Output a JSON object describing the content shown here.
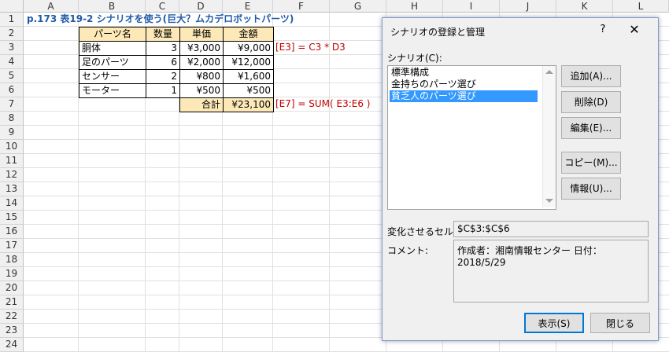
{
  "columns": [
    "A",
    "B",
    "C",
    "D",
    "E",
    "F",
    "G",
    "H",
    "I",
    "J",
    "K",
    "L"
  ],
  "rows": [
    "1",
    "2",
    "3",
    "4",
    "5",
    "6",
    "7",
    "8",
    "9",
    "10",
    "11",
    "12",
    "13",
    "14",
    "15",
    "16",
    "17",
    "18",
    "19",
    "20",
    "21",
    "22",
    "23",
    "24"
  ],
  "title": "p.173 表19-2 シナリオを使う(巨大？ムカデロボットパーツ)",
  "table": {
    "headers": [
      "パーツ名",
      "数量",
      "単価",
      "金額"
    ],
    "rows": [
      {
        "name": "胴体",
        "qty": "3",
        "price": "¥3,000",
        "amount": "¥9,000"
      },
      {
        "name": "足のパーツ",
        "qty": "6",
        "price": "¥2,000",
        "amount": "¥12,000"
      },
      {
        "name": "センサー",
        "qty": "2",
        "price": "¥800",
        "amount": "¥1,600"
      },
      {
        "name": "モーター",
        "qty": "1",
        "price": "¥500",
        "amount": "¥500"
      }
    ],
    "total_label": "合計",
    "total_value": "¥23,100"
  },
  "notes": {
    "e3": "[E3] = C3 * D3",
    "e7": "[E7] = SUM( E3:E6 )"
  },
  "dialog": {
    "title": "シナリオの登録と管理",
    "help": "?",
    "close": "✕",
    "scenarios_label": "シナリオ(C):",
    "scenarios": [
      "標準構成",
      "金持ちのパーツ選び",
      "貧乏人のパーツ選び"
    ],
    "selected_index": 2,
    "buttons": {
      "add": "追加(A)...",
      "delete": "削除(D)",
      "edit": "編集(E)...",
      "copy": "コピー(M)...",
      "info": "情報(U)...",
      "show": "表示(S)",
      "close": "閉じる"
    },
    "changing_cells_label": "変化させるセル:",
    "changing_cells_value": "$C$3:$C$6",
    "comment_label": "コメント:",
    "comment_value": "作成者：湘南情報センター 日付：2018/5/29"
  },
  "colors": {
    "header_fill": "#fde9b8",
    "title": "#1f5aa8",
    "note": "#c00000",
    "selection": "#3399ff"
  }
}
